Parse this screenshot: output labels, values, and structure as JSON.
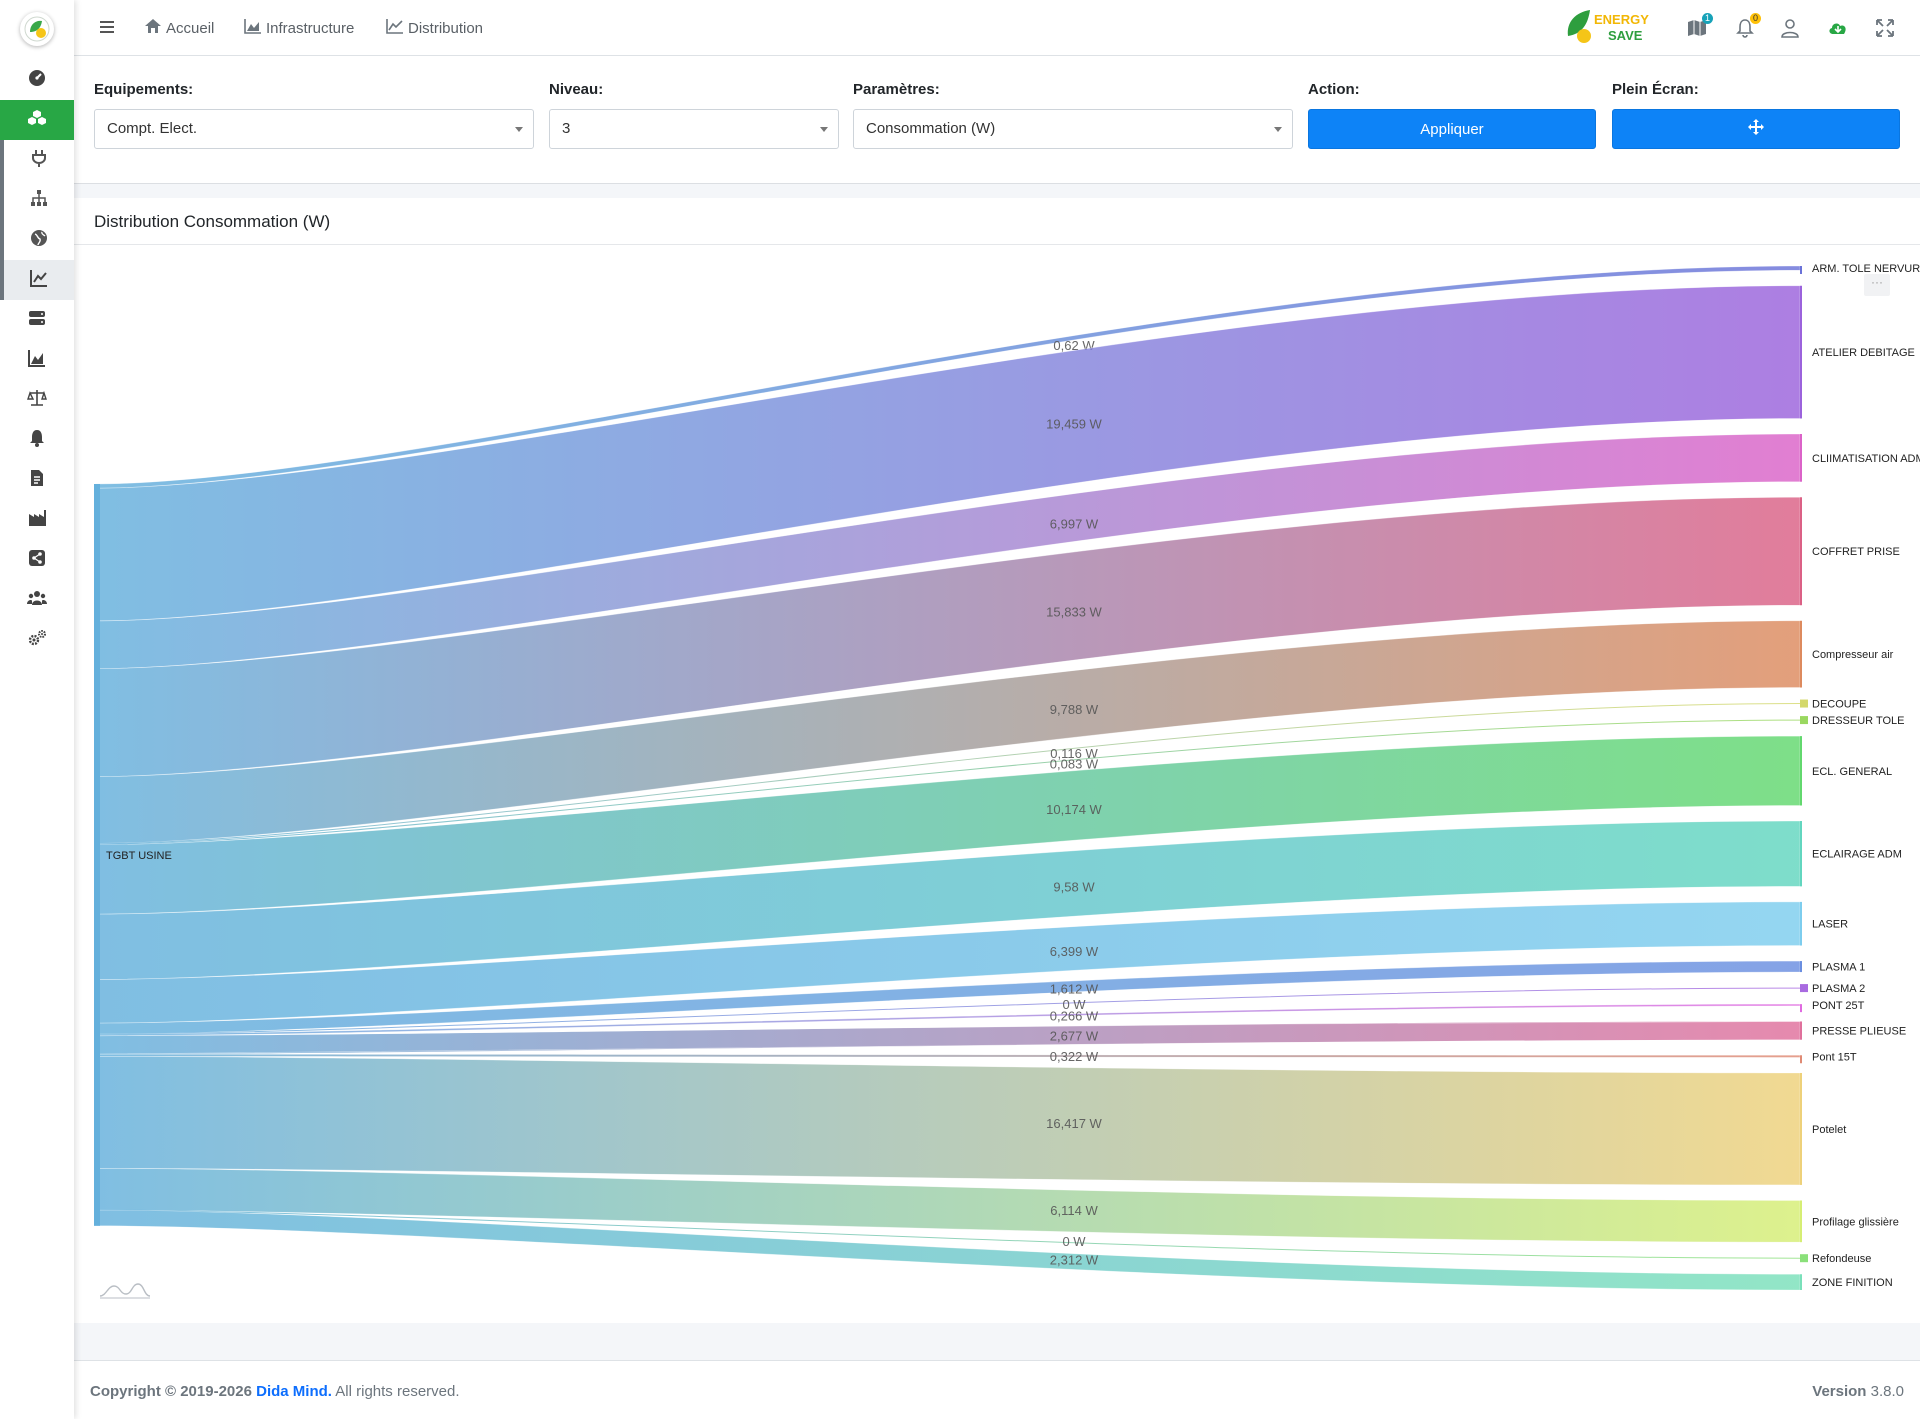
{
  "nav": {
    "links": [
      {
        "label": "Accueil",
        "icon": "home-icon"
      },
      {
        "label": "Infrastructure",
        "icon": "chart-area-icon"
      },
      {
        "label": "Distribution",
        "icon": "chart-line-icon"
      }
    ],
    "brand_line1": "ENERGY",
    "brand_line2": "SAVE",
    "badges": {
      "map": "1",
      "alerts": "0"
    }
  },
  "sidebar": {
    "items": [
      {
        "icon": "dashboard-icon"
      },
      {
        "icon": "cubes-icon",
        "active": true
      },
      {
        "icon": "plug-icon"
      },
      {
        "icon": "sitemap-icon"
      },
      {
        "icon": "globe-icon"
      },
      {
        "icon": "chart-line-icon",
        "current": true
      },
      {
        "icon": "server-icon"
      },
      {
        "icon": "chart-area-icon"
      },
      {
        "icon": "balance-scale-icon"
      },
      {
        "icon": "bell-icon"
      },
      {
        "icon": "file-invoice-icon"
      },
      {
        "icon": "industry-icon"
      },
      {
        "icon": "share-icon"
      },
      {
        "icon": "users-icon"
      },
      {
        "icon": "cogs-icon"
      }
    ]
  },
  "filters": {
    "equipements_label": "Equipements:",
    "equipements_value": "Compt. Elect.",
    "niveau_label": "Niveau:",
    "niveau_value": "3",
    "parametres_label": "Paramètres:",
    "parametres_value": "Consommation (W)",
    "action_label": "Action:",
    "action_button": "Appliquer",
    "fullscreen_label": "Plein Écran:",
    "fullscreen_icon": "arrows-icon"
  },
  "chart_card": {
    "title": "Distribution Consommation (W)"
  },
  "chart_data": {
    "type": "sankey",
    "unit": "W",
    "source": "TGBT USINE",
    "colors": {
      "source": "#64b0dc"
    },
    "links": [
      {
        "target": "ARM. TOLE NERVURE",
        "value": 0.62,
        "label": "0,62 W",
        "color": "#6a72d8"
      },
      {
        "target": "ATELIER DEBITAGE",
        "value": 19.459,
        "label": "19,459 W",
        "color": "#9b62dc"
      },
      {
        "target": "CLIIMATISATION ADM",
        "value": 6.997,
        "label": "6,997 W",
        "color": "#db62c8"
      },
      {
        "target": "COFFRET PRISE",
        "value": 15.833,
        "label": "15,833 W",
        "color": "#db6085"
      },
      {
        "target": "Compresseur air",
        "value": 9.788,
        "label": "9,788 W",
        "color": "#dd8a5e"
      },
      {
        "target": "DECOUPE",
        "value": 0.116,
        "label": "0,116 W",
        "color": "#d4d86a"
      },
      {
        "target": "DRESSEUR TOLE",
        "value": 0.083,
        "label": "0,083 W",
        "color": "#9ad860"
      },
      {
        "target": "ECL. GENERAL",
        "value": 10.174,
        "label": "10,174 W",
        "color": "#62d86e"
      },
      {
        "target": "ECLAIRAGE ADM",
        "value": 9.58,
        "label": "9,58 W",
        "color": "#62d6bf"
      },
      {
        "target": "LASER",
        "value": 6.399,
        "label": "6,399 W",
        "color": "#7dcdee"
      },
      {
        "target": "PLASMA 1",
        "value": 1.612,
        "label": "1,612 W",
        "color": "#6a8ee0"
      },
      {
        "target": "PLASMA 2",
        "value": 0,
        "label": "0 W",
        "color": "#a86ae0"
      },
      {
        "target": "PONT 25T",
        "value": 0.266,
        "label": "0,266 W",
        "color": "#e06ae0"
      },
      {
        "target": "PRESSE PLIEUSE",
        "value": 2.677,
        "label": "2,677 W",
        "color": "#e0709c"
      },
      {
        "target": "Pont 15T",
        "value": 0.322,
        "label": "0,322 W",
        "color": "#e08a74"
      },
      {
        "target": "Potelet",
        "value": 16.417,
        "label": "16,417 W",
        "color": "#eed17a"
      },
      {
        "target": "Profilage glissière",
        "value": 6.114,
        "label": "6,114 W",
        "color": "#d6ee74"
      },
      {
        "target": "Refondeuse",
        "value": 0,
        "label": "0 W",
        "color": "#8ae07a"
      },
      {
        "target": "ZONE FINITION",
        "value": 2.312,
        "label": "2,312 W",
        "color": "#7ae0ba"
      }
    ]
  },
  "footer": {
    "copyright_prefix": "Copyright © 2019-2026 ",
    "company": "Dida Mind.",
    "rights": " All rights reserved.",
    "version_label": "Version",
    "version": " 3.8.0"
  }
}
